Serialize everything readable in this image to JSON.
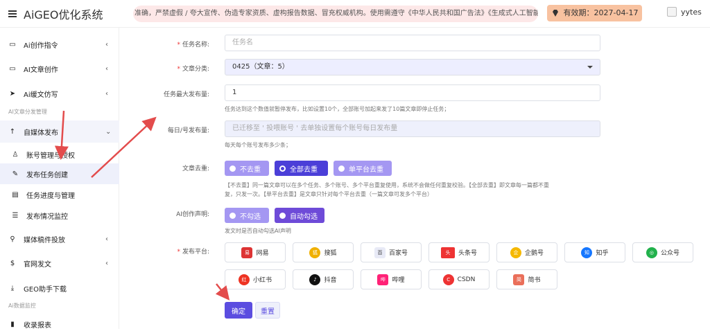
{
  "app": {
    "title": "AiGEO优化系统"
  },
  "header": {
    "marquee": "准确，严禁虚假 / 夸大宣传、伪造专家资质、虚构报告数据、冒充权威机构。使用需遵守《中华人民共和国广告法》《生成式人工智能",
    "expiry": "有效期：2027-04-17",
    "username": "yytes"
  },
  "sidebar": {
    "items": [
      {
        "label": "Ai创作指令",
        "icon": "folder-icon"
      },
      {
        "label": "AI文章创作",
        "icon": "folder-icon"
      },
      {
        "label": "Ai缓文仿写",
        "icon": "send-icon"
      }
    ],
    "section1": "AI文章分发管理",
    "group": {
      "label": "自媒体发布",
      "icon": "up-arrow-icon"
    },
    "sub": [
      {
        "label": "账号管理与授权",
        "icon": "user-icon"
      },
      {
        "label": "发布任务创建",
        "icon": "edit-icon"
      },
      {
        "label": "任务进度与管理",
        "icon": "list-icon"
      },
      {
        "label": "发布情况监控",
        "icon": "list-icon"
      }
    ],
    "items2": [
      {
        "label": "媒体稿件投放",
        "icon": "search-icon"
      },
      {
        "label": "官网发文",
        "icon": "dollar-icon"
      },
      {
        "label": "GEO助手下载",
        "icon": "download-icon"
      }
    ],
    "section2": "Ai数据监控",
    "last": "收录报表"
  },
  "form": {
    "task_name": {
      "label": "任务名称:",
      "placeholder": "任务名"
    },
    "category": {
      "label": "文章分类:",
      "value": "0425（文章：5）"
    },
    "max_publish": {
      "label": "任务最大发布量:",
      "value": "1",
      "hint": "任务达到这个数值就暂停发布，比如设置10个，全部账号加起来发了10篇文章即停止任务；"
    },
    "daily": {
      "label": "每日/号发布量:",
      "placeholder": "已迁移至 ' 投喂账号 ' 去单独设置每个账号每日发布量",
      "hint": "每天每个账号发布多少条；"
    },
    "dedup": {
      "label": "文章去重:",
      "options": [
        "不去重",
        "全部去重",
        "单平台去重"
      ],
      "selected": 1,
      "hint1": "【不去重】同一篇文章可以在多个任务、多个账号、多个平台重复使用，系统不会做任何重复校验。【全部去重】即文章每一篇都不重",
      "hint2": "复，只发一次。【单平台去重】是文章只针对每个平台去重（一篇文章可发多个平台）"
    },
    "ai_notice": {
      "label": "AI创作声明:",
      "options": [
        "不勾选",
        "自动勾选"
      ],
      "selected": 1,
      "hint": "发文时是否自动勾选AI声明"
    },
    "platforms": {
      "label": "发布平台:",
      "items": [
        "网易",
        "搜狐",
        "百家号",
        "头条号",
        "企鹅号",
        "知乎",
        "公众号",
        "小红书",
        "抖音",
        "哔哩",
        "CSDN",
        "简书"
      ]
    },
    "submit": "确定",
    "reset": "重置"
  },
  "colors": {
    "accent": "#5b4de0",
    "marquee_bg": "#fde8e8",
    "expiry_bg": "#f8c2a0"
  }
}
